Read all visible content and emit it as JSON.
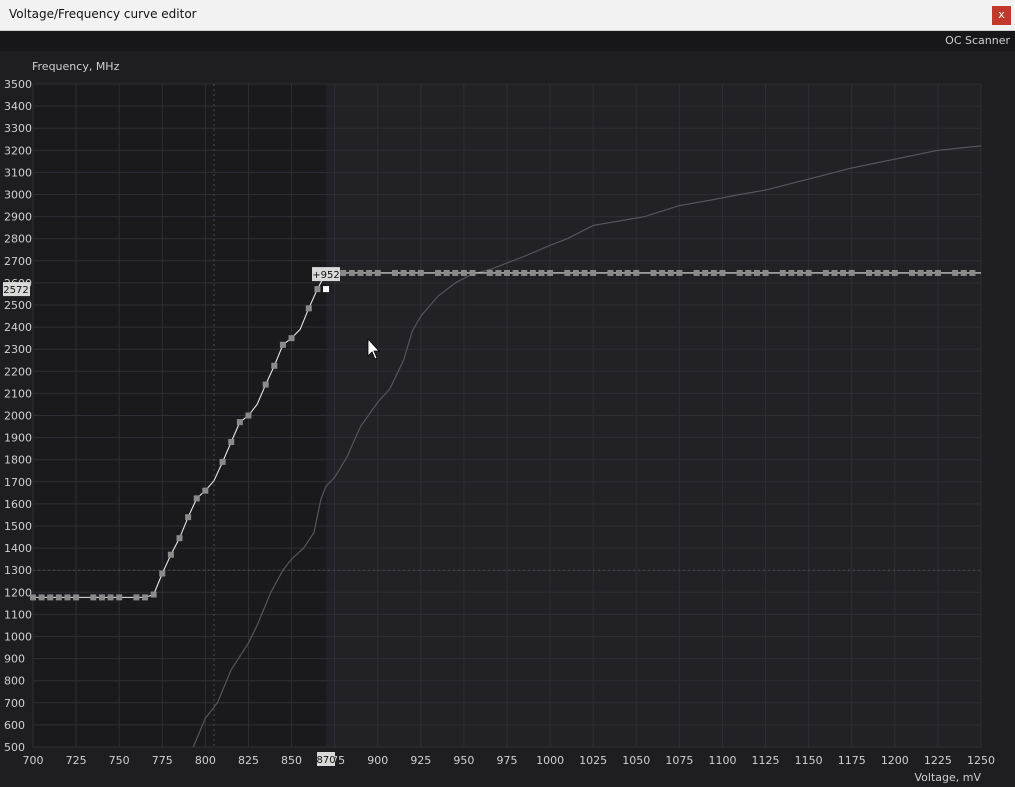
{
  "window": {
    "title": "Voltage/Frequency curve editor",
    "close_label": "x"
  },
  "toolbar": {
    "oc_scanner_label": "OC Scanner"
  },
  "colors": {
    "plot_bg": "#212126",
    "locked_region": "#1a1a1d",
    "grid": "#2e2e34",
    "curve": "#e6e6e6",
    "default_curve": "#55555c",
    "point": "#8a8a8a",
    "guide": "#4a4a4a"
  },
  "chart_data": {
    "type": "line",
    "ylabel": "Frequency, MHz",
    "xlabel": "Voltage, mV",
    "xlim": [
      700,
      1250
    ],
    "ylim": [
      500,
      3500
    ],
    "x_ticks": [
      700,
      725,
      750,
      775,
      800,
      825,
      850,
      875,
      900,
      925,
      950,
      975,
      1000,
      1025,
      1050,
      1075,
      1100,
      1125,
      1150,
      1175,
      1200,
      1225,
      1250
    ],
    "y_ticks": [
      500,
      600,
      700,
      800,
      900,
      1000,
      1100,
      1200,
      1300,
      1400,
      1500,
      1600,
      1700,
      1800,
      1900,
      2000,
      2100,
      2200,
      2300,
      2400,
      2500,
      2600,
      2700,
      2800,
      2900,
      3000,
      3100,
      3200,
      3300,
      3400,
      3500
    ],
    "series": [
      {
        "role": "default",
        "x": [
          793,
          800,
          807,
          815,
          825,
          830,
          838,
          845,
          850,
          857,
          863,
          867,
          870,
          875,
          882,
          890,
          900,
          907,
          915,
          920,
          925,
          935,
          945,
          955,
          965,
          975,
          985,
          1000,
          1010,
          1025,
          1040,
          1055,
          1075,
          1090,
          1110,
          1125,
          1150,
          1175,
          1200,
          1225,
          1250
        ],
        "y": [
          500,
          630,
          700,
          850,
          970,
          1050,
          1200,
          1300,
          1350,
          1400,
          1470,
          1620,
          1680,
          1720,
          1810,
          1950,
          2060,
          2120,
          2250,
          2380,
          2450,
          2540,
          2600,
          2640,
          2660,
          2690,
          2720,
          2770,
          2800,
          2860,
          2880,
          2900,
          2950,
          2970,
          3000,
          3020,
          3070,
          3120,
          3160,
          3200,
          3220
        ]
      },
      {
        "role": "current",
        "x": [
          700,
          705,
          710,
          715,
          720,
          725,
          735,
          740,
          745,
          750,
          755,
          760,
          765,
          770,
          775,
          780,
          785,
          790,
          795,
          800,
          805,
          810,
          815,
          820,
          825,
          830,
          835,
          840,
          845,
          850,
          855,
          860,
          865,
          870,
          875,
          880,
          885,
          890,
          895,
          900,
          905,
          910,
          915,
          920,
          925,
          930,
          935,
          940,
          945,
          950,
          955,
          960,
          965,
          970,
          975,
          980,
          985,
          990,
          995,
          1000,
          1005,
          1010,
          1015,
          1020,
          1025,
          1030,
          1035,
          1040,
          1045,
          1050,
          1055,
          1060,
          1065,
          1070,
          1075,
          1080,
          1085,
          1090,
          1095,
          1100,
          1105,
          1110,
          1115,
          1120,
          1125,
          1130,
          1135,
          1140,
          1145,
          1150,
          1155,
          1160,
          1165,
          1170,
          1175,
          1180,
          1185,
          1190,
          1195,
          1200,
          1205,
          1210,
          1215,
          1220,
          1225,
          1230,
          1235,
          1240,
          1245,
          1250
        ],
        "y": [
          1177,
          1177,
          1177,
          1177,
          1177,
          1177,
          1177,
          1177,
          1177,
          1177,
          1177,
          1177,
          1177,
          1190,
          1285,
          1370,
          1445,
          1540,
          1625,
          1660,
          1705,
          1790,
          1880,
          1970,
          2000,
          2050,
          2140,
          2225,
          2320,
          2350,
          2390,
          2485,
          2572,
          2645,
          2645,
          2645,
          2645,
          2645,
          2645,
          2645,
          2645,
          2645,
          2645,
          2645,
          2645,
          2645,
          2645,
          2645,
          2645,
          2645,
          2645,
          2645,
          2645,
          2645,
          2645,
          2645,
          2645,
          2645,
          2645,
          2645,
          2645,
          2645,
          2645,
          2645,
          2645,
          2645,
          2645,
          2645,
          2645,
          2645,
          2645,
          2645,
          2645,
          2645,
          2645,
          2645,
          2645,
          2645,
          2645,
          2645,
          2645,
          2645,
          2645,
          2645,
          2645,
          2645,
          2645,
          2645,
          2645,
          2645,
          2645,
          2645,
          2645,
          2645,
          2645,
          2645,
          2645,
          2645,
          2645,
          2645,
          2645,
          2645,
          2645,
          2645,
          2645,
          2645,
          2645,
          2645,
          2645,
          2645
        ]
      }
    ],
    "point_voltages": [
      700,
      705,
      710,
      715,
      720,
      725,
      735,
      740,
      745,
      750,
      760,
      765,
      770,
      775,
      780,
      785,
      790,
      795,
      800,
      810,
      815,
      820,
      825,
      835,
      840,
      845,
      850,
      860,
      865,
      870,
      875,
      880,
      885,
      890,
      895,
      900,
      910,
      915,
      920,
      925,
      935,
      940,
      945,
      950,
      955,
      965,
      970,
      975,
      980,
      985,
      990,
      995,
      1000,
      1010,
      1015,
      1020,
      1025,
      1035,
      1040,
      1045,
      1050,
      1060,
      1065,
      1070,
      1075,
      1085,
      1090,
      1095,
      1100,
      1110,
      1115,
      1120,
      1125,
      1135,
      1140,
      1145,
      1150,
      1160,
      1165,
      1170,
      1175,
      1185,
      1190,
      1195,
      1200,
      1210,
      1215,
      1220,
      1225,
      1235,
      1240,
      1245
    ],
    "locked_voltage": 870,
    "selected_point": {
      "x": 870,
      "y": 2572,
      "offset_label": "+952",
      "freq_label": "2572",
      "volt_label": "870"
    },
    "crosshair": {
      "x": 805,
      "y": 1300
    }
  }
}
